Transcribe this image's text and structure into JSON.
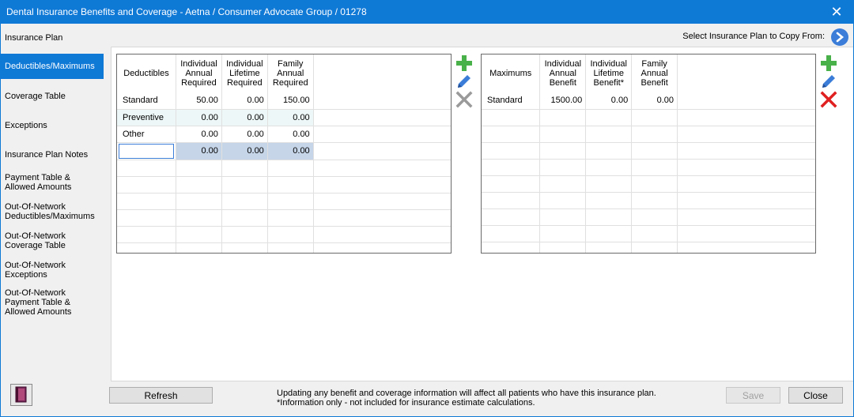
{
  "window": {
    "title": "Dental Insurance Benefits and Coverage - Aetna / Consumer Advocate Group / 01278",
    "close_glyph": "✕"
  },
  "sidebar": {
    "items": [
      {
        "label": "Insurance Plan"
      },
      {
        "label": "Deductibles/Maximums",
        "selected": true
      },
      {
        "label": "Coverage Table"
      },
      {
        "label": "Exceptions"
      },
      {
        "label": "Insurance Plan Notes"
      },
      {
        "label": "Payment Table &\nAllowed Amounts"
      },
      {
        "label": "Out-Of-Network\nDeductibles/Maximums"
      },
      {
        "label": "Out-Of-Network\nCoverage Table"
      },
      {
        "label": "Out-Of-Network\nExceptions"
      },
      {
        "label": "Out-Of-Network\nPayment Table &\nAllowed Amounts"
      }
    ],
    "help_icon": "book-icon"
  },
  "copy_from": {
    "label": "Select Insurance Plan to Copy From:",
    "icon": "arrow-right-circle-icon"
  },
  "deductibles": {
    "headers": [
      "Deductibles",
      "Individual\nAnnual\nRequired",
      "Individual\nLifetime\nRequired",
      "Family\nAnnual\nRequired"
    ],
    "rows": [
      [
        "Standard",
        "50.00",
        "0.00",
        "150.00"
      ],
      [
        "Preventive",
        "0.00",
        "0.00",
        "0.00"
      ],
      [
        "Other",
        "0.00",
        "0.00",
        "0.00"
      ]
    ],
    "new_row": {
      "value": "",
      "cells": [
        "0.00",
        "0.00",
        "0.00"
      ]
    }
  },
  "maximums": {
    "headers": [
      "Maximums",
      "Individual\nAnnual\nBenefit",
      "Individual\nLifetime\nBenefit*",
      "Family\nAnnual\nBenefit"
    ],
    "rows": [
      [
        "Standard",
        "1500.00",
        "0.00",
        "0.00"
      ]
    ]
  },
  "tools": {
    "add_icon": "plus-icon",
    "edit_icon": "pencil-icon",
    "delete_icon": "delete-x-icon",
    "colors": {
      "add": "#49b14a",
      "edit": "#3b7dd8",
      "delete_disabled": "#9a9a9a",
      "delete_active": "#e02020"
    }
  },
  "footer": {
    "refresh_label": "Refresh",
    "note_line1": "Updating any benefit and coverage information will affect all patients who have this insurance plan.",
    "note_line2": "*Information only - not included for insurance estimate calculations.",
    "save_label": "Save",
    "close_label": "Close"
  },
  "colors": {
    "accent": "#0f79d6",
    "edit_row": "#c6d5e8",
    "alt_row": "#eef7f7"
  }
}
